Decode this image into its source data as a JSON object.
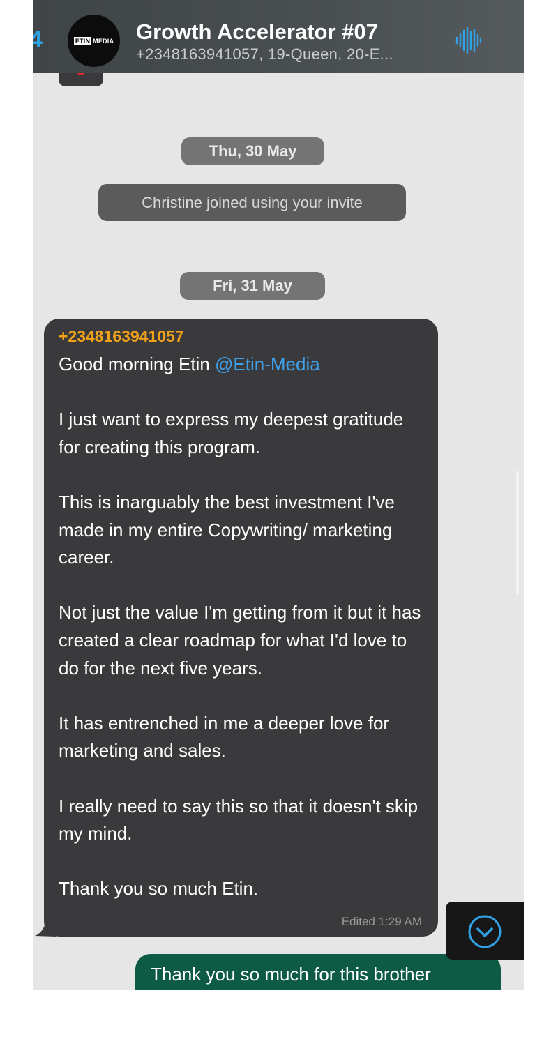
{
  "header": {
    "back_glyph": "4",
    "avatar": {
      "box_text": "ETIN",
      "word_text": "MEDIA"
    },
    "title": "Growth Accelerator #07",
    "subtitle": "+2348163941057, 19-Queen, 20-E...",
    "voice_icon": "audio-wave-icon"
  },
  "chat": {
    "date_separators": [
      "Thu, 30 May",
      "Fri, 31 May"
    ],
    "system_message": "Christine joined using your invite",
    "incoming_message": {
      "sender": "+2348163941057",
      "greeting": "Good morning Etin ",
      "mention": "@Etin-Media",
      "paragraphs": [
        "I just want to express my deepest gratitude for creating this program.",
        "This is inarguably the best investment I've made in my entire Copywriting/ marketing career.",
        "Not just the value I'm getting from it but it has created a clear roadmap for what I'd love to do for the next five years.",
        "It has entrenched in me a deeper love for marketing and sales.",
        "I really need to say this so that it doesn't skip my mind.",
        "Thank you so much Etin."
      ],
      "meta": "Edited 1:29 AM"
    },
    "outgoing_message": {
      "text": "Thank you so much for this brother"
    }
  },
  "colors": {
    "header_bg": "#4a4f51",
    "chat_bg": "#e6e6e6",
    "bubble_in": "#3a3a3c",
    "bubble_out": "#0d5a45",
    "sender": "#f0a21a",
    "mention": "#3f9fe9",
    "accent": "#2fa3e6"
  },
  "icons": [
    "audio-wave-icon",
    "chevron-down-circle-icon",
    "heart-reaction-icon"
  ]
}
